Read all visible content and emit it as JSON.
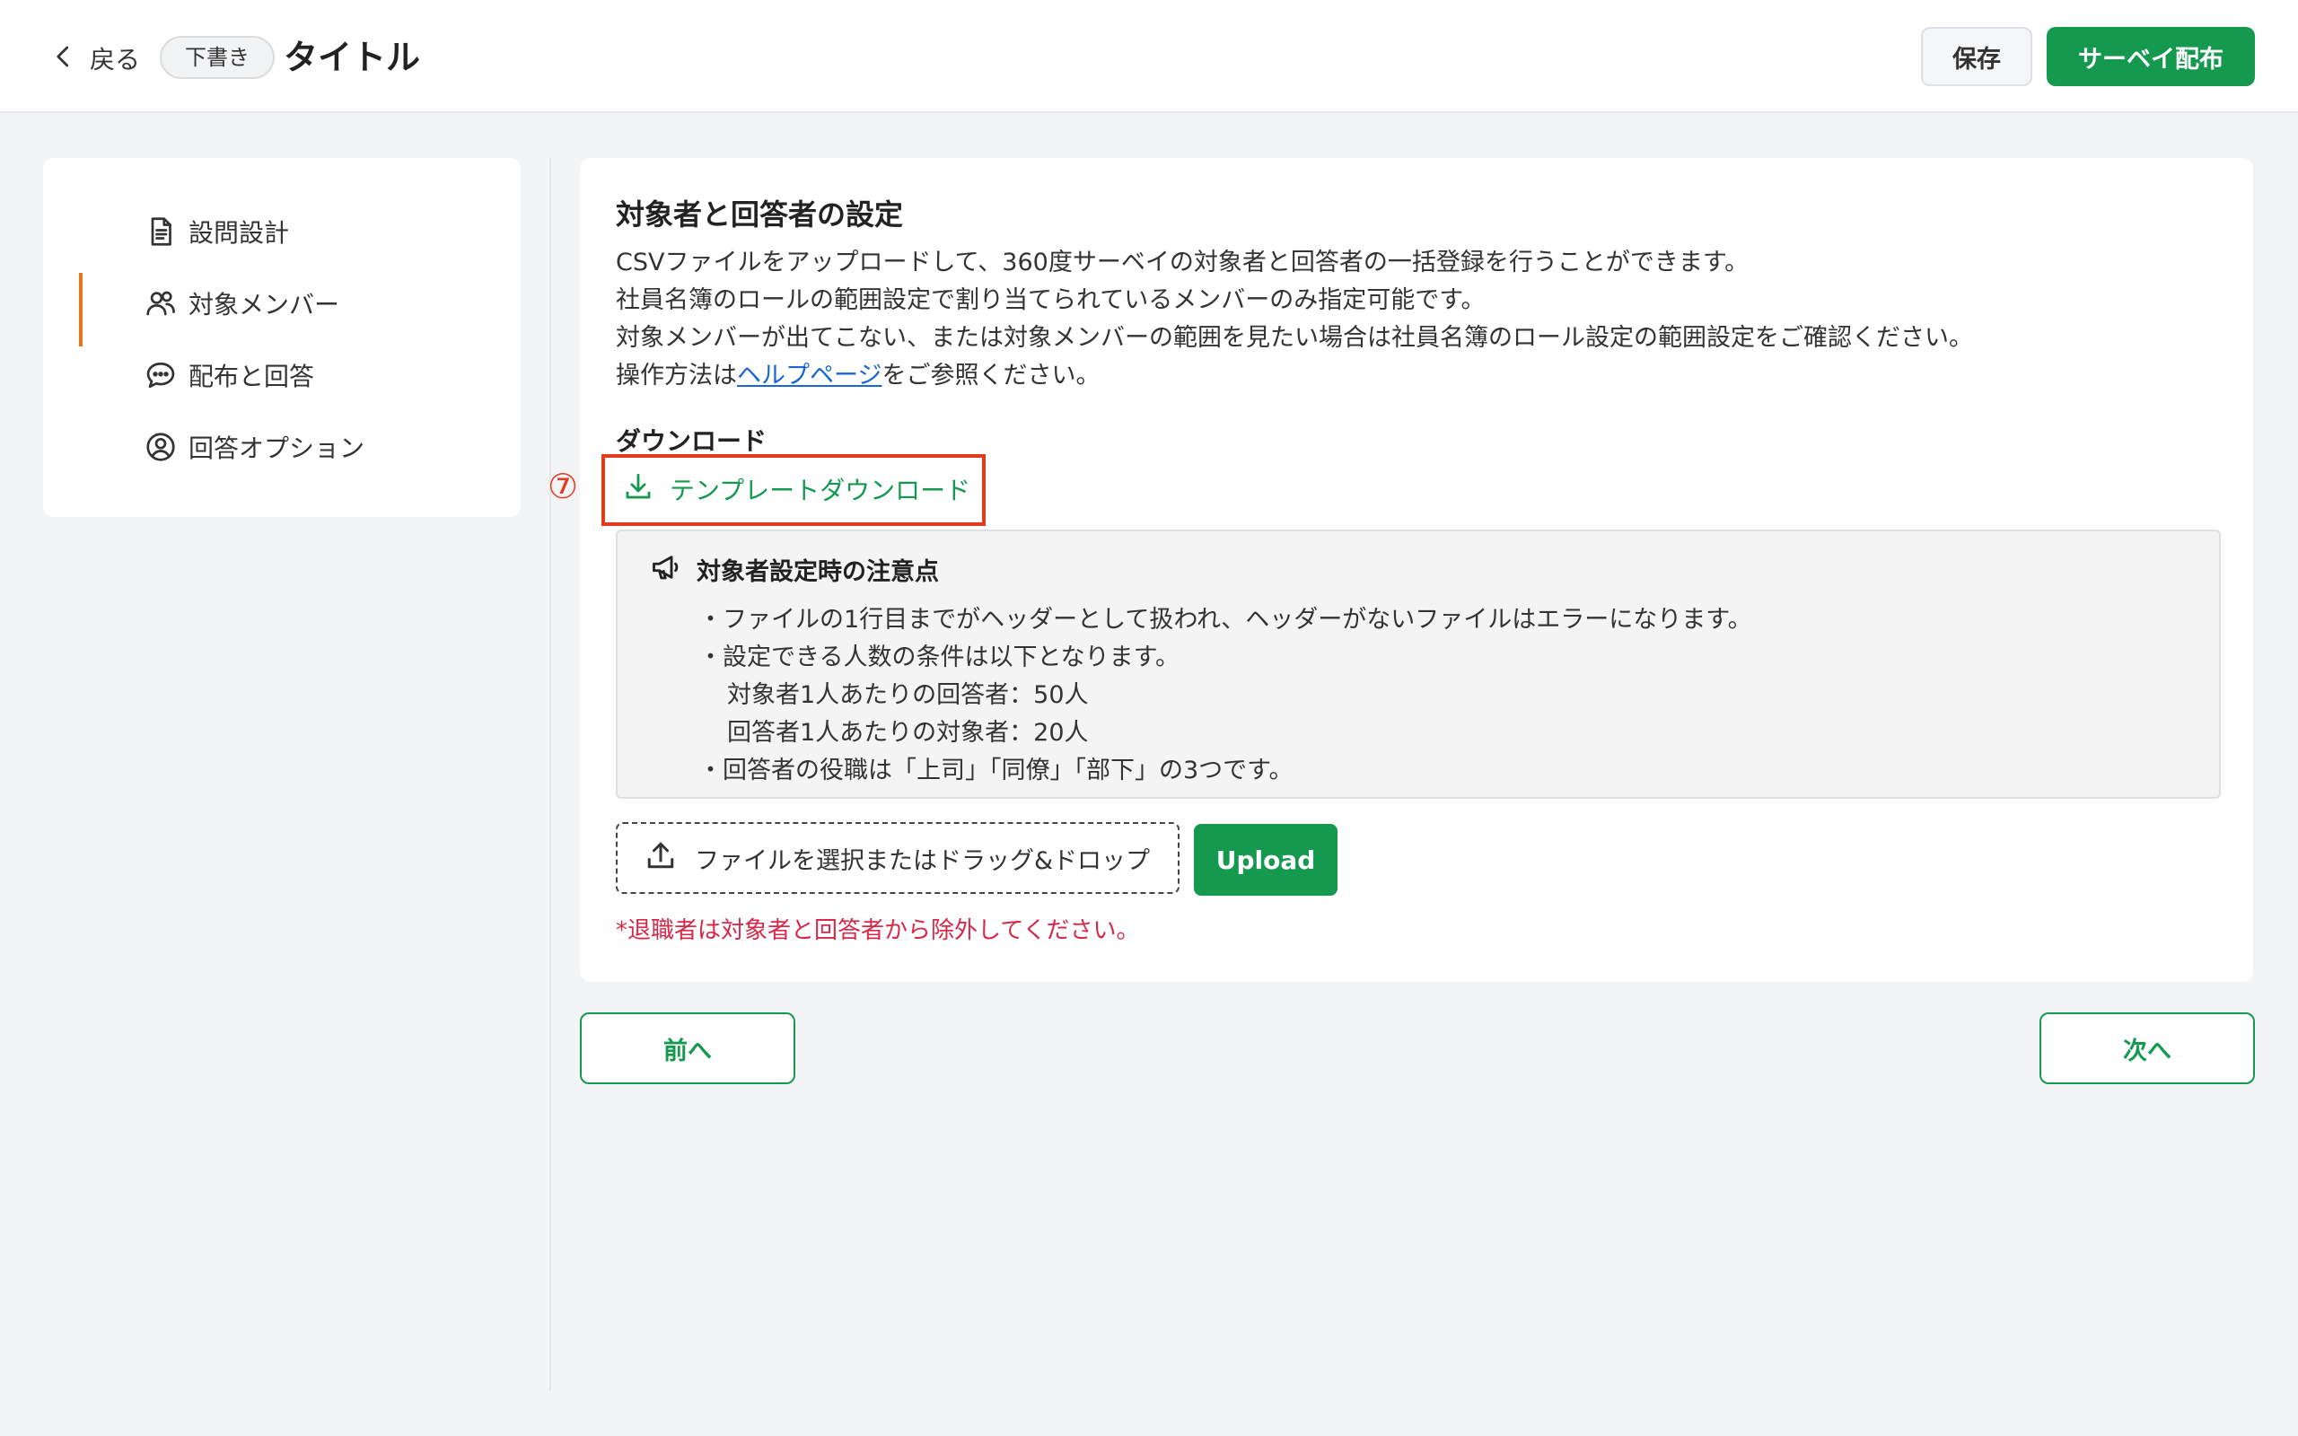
{
  "header": {
    "back_label": "戻る",
    "status_badge": "下書き",
    "title": "タイトル",
    "save_label": "保存",
    "distribute_label": "サーベイ配布"
  },
  "sidebar": {
    "items": [
      {
        "label": "設問設計",
        "icon": "document-icon",
        "active": false
      },
      {
        "label": "対象メンバー",
        "icon": "users-icon",
        "active": true
      },
      {
        "label": "配布と回答",
        "icon": "chat-bubble-icon",
        "active": false
      },
      {
        "label": "回答オプション",
        "icon": "user-circle-icon",
        "active": false
      }
    ]
  },
  "main": {
    "section_title": "対象者と回答者の設定",
    "description": [
      "CSVファイルをアップロードして、360度サーベイの対象者と回答者の一括登録を行うことができます。",
      "社員名簿のロールの範囲設定で割り当てられているメンバーのみ指定可能です。",
      "対象メンバーが出てこない、または対象メンバーの範囲を見たい場合は社員名簿のロール設定の範囲設定をご確認ください。"
    ],
    "help_prefix": "操作方法は",
    "help_link": "ヘルプページ",
    "help_suffix": "をご参照ください。",
    "download_heading": "ダウンロード",
    "callout_number": "⑦",
    "template_download_label": "テンプレートダウンロード",
    "notice": {
      "title": "対象者設定時の注意点",
      "items": [
        "・ファイルの1行目までがヘッダーとして扱われ、ヘッダーがないファイルはエラーになります。",
        "・設定できる人数の条件は以下となります。",
        "対象者1人あたりの回答者：50人",
        "回答者1人あたりの対象者：20人",
        "・回答者の役職は「上司」「同僚」「部下」の3つです。"
      ]
    },
    "file_drop_label": "ファイルを選択またはドラッグ&ドロップ",
    "upload_label": "Upload",
    "warning": "*退職者は対象者と回答者から除外してください。"
  },
  "footer": {
    "prev_label": "前へ",
    "next_label": "次へ"
  },
  "colors": {
    "primary_green": "#15994f",
    "active_indicator": "#e8761a",
    "highlight_red": "#e23b1e",
    "warning_red": "#d8284a",
    "link_blue": "#1a66d6"
  }
}
